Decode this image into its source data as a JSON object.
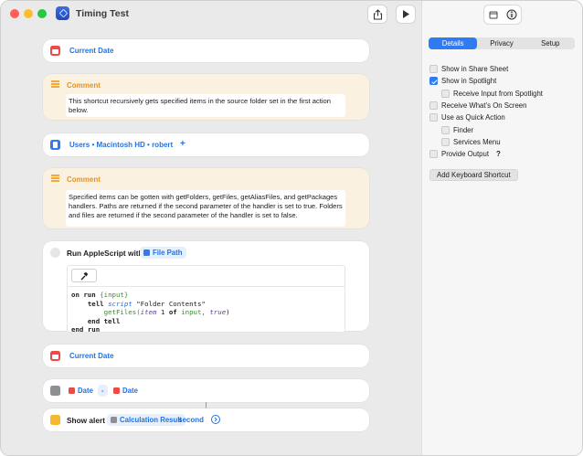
{
  "window": {
    "title": "Timing Test",
    "traffic_colors": [
      "#ff5f57",
      "#febc2e",
      "#28c840"
    ]
  },
  "toolbar": {
    "share_icon": "share-icon",
    "run_icon": "play-icon"
  },
  "actions": {
    "a1": {
      "label": "Current Date"
    },
    "a2": {
      "label": "Comment",
      "text": "This shortcut recursively gets specified items in the source folder set in the first action below."
    },
    "a3": {
      "label": "Users • Macintosh HD • robert",
      "add": "+"
    },
    "a4": {
      "label": "Comment",
      "text": "Specified items can be gotten with getFolders, getFiles, getAliasFiles, and getPackages handlers. Paths are returned if the second parameter of the handler is set to true. Folders and files are returned if the second parameter of the handler is set to false."
    },
    "a5": {
      "label": "Run AppleScript with",
      "input": "File Path"
    },
    "a6": {
      "label": "Current Date"
    },
    "a7": {
      "left": "Date",
      "op": "-",
      "right": "Date"
    },
    "a8": {
      "label": "Show alert",
      "var": "Calculation Result",
      "unit": "second"
    }
  },
  "code": {
    "l1_kw": "on",
    "l1_kw2": "run",
    "l1_arg": "{input}",
    "l2_kw": "tell",
    "l2_obj": "script",
    "l2_str": "\"Folder Contents\"",
    "l3_fn": "getFiles(",
    "l3_item": "item",
    "l3_mid": " 1 ",
    "l3_of": "of",
    "l3_input": " input, ",
    "l3_true": "true",
    "l3_end": ")",
    "l4_kw": "end tell",
    "l5_kw": "end",
    "l5_kw2": "run"
  },
  "panel": {
    "tabs": [
      "Details",
      "Privacy",
      "Setup"
    ],
    "active_tab": "Details",
    "options": {
      "share_sheet": "Show in Share Sheet",
      "spotlight": "Show in Spotlight",
      "spotlight_input": "Receive Input from Spotlight",
      "onscreen": "Receive What’s On Screen",
      "quick_action": "Use as Quick Action",
      "finder": "Finder",
      "services": "Services Menu",
      "output": "Provide Output"
    },
    "output_help": "?",
    "keyboard_button": "Add Keyboard Shortcut"
  },
  "colors": {
    "accent": "#2f7bf5",
    "comment_bg": "#fbf1e1",
    "comment_label": "#e3932b"
  }
}
